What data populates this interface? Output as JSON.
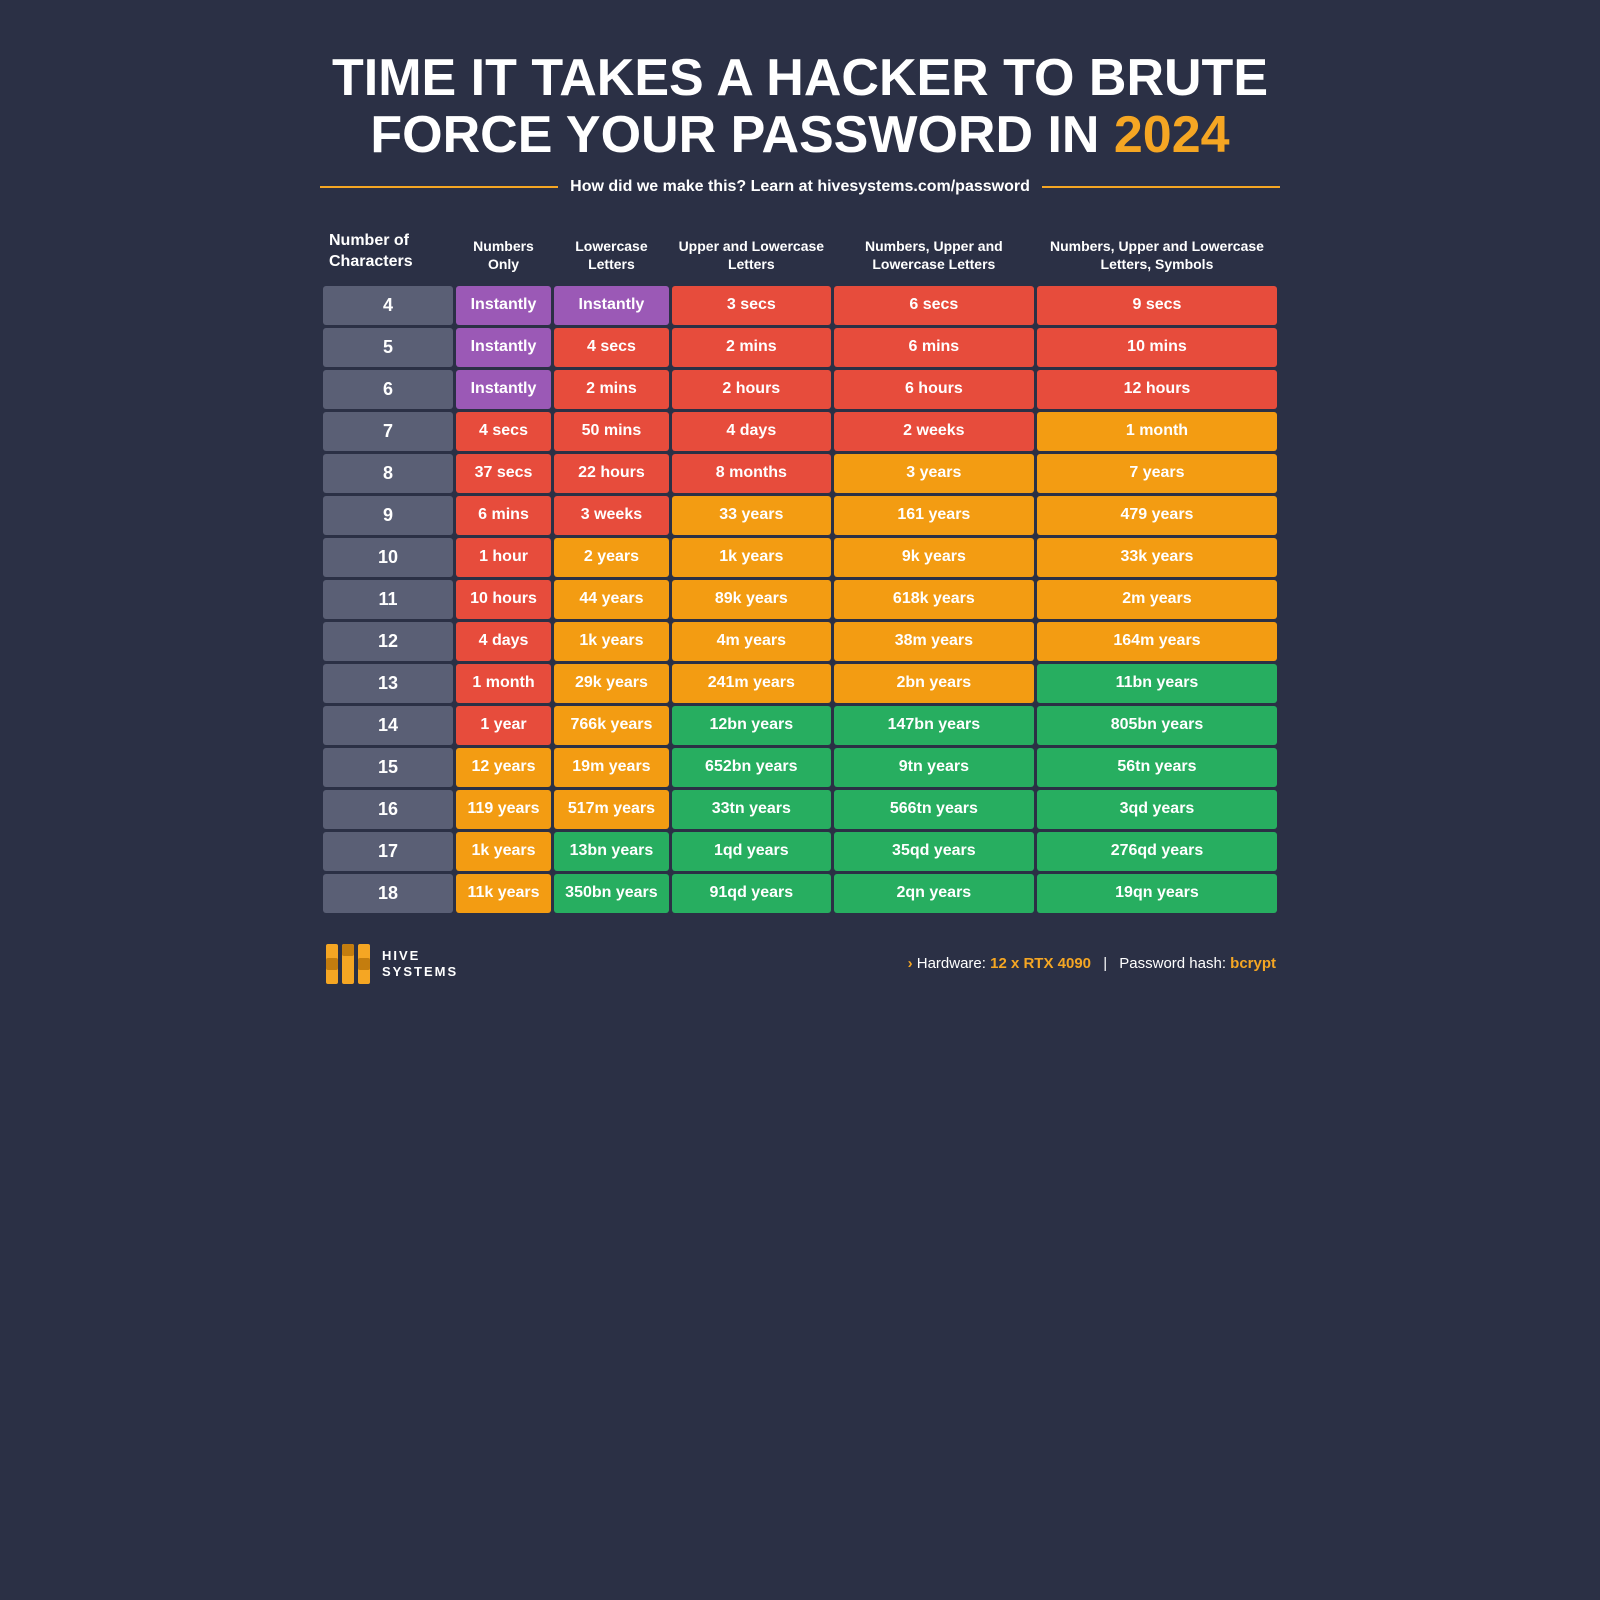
{
  "title": {
    "line1": "TIME IT TAKES A HACKER TO BRUTE",
    "line2": "FORCE YOUR PASSWORD IN",
    "year": "2024"
  },
  "subtitle": "How did we make this? Learn at hivesystems.com/password",
  "table": {
    "headers": [
      "Number of Characters",
      "Numbers Only",
      "Lowercase Letters",
      "Upper and Lowercase Letters",
      "Numbers, Upper and Lowercase Letters",
      "Numbers, Upper and Lowercase Letters, Symbols"
    ],
    "rows": [
      {
        "chars": "4",
        "c1": "Instantly",
        "c1_color": "purple",
        "c2": "Instantly",
        "c2_color": "purple",
        "c3": "3 secs",
        "c3_color": "red",
        "c4": "6 secs",
        "c4_color": "red",
        "c5": "9 secs",
        "c5_color": "red"
      },
      {
        "chars": "5",
        "c1": "Instantly",
        "c1_color": "purple",
        "c2": "4 secs",
        "c2_color": "red",
        "c3": "2 mins",
        "c3_color": "red",
        "c4": "6 mins",
        "c4_color": "red",
        "c5": "10 mins",
        "c5_color": "red"
      },
      {
        "chars": "6",
        "c1": "Instantly",
        "c1_color": "purple",
        "c2": "2 mins",
        "c2_color": "red",
        "c3": "2 hours",
        "c3_color": "red",
        "c4": "6 hours",
        "c4_color": "red",
        "c5": "12 hours",
        "c5_color": "red"
      },
      {
        "chars": "7",
        "c1": "4 secs",
        "c1_color": "red",
        "c2": "50 mins",
        "c2_color": "red",
        "c3": "4 days",
        "c3_color": "red",
        "c4": "2 weeks",
        "c4_color": "red",
        "c5": "1 month",
        "c5_color": "orange"
      },
      {
        "chars": "8",
        "c1": "37 secs",
        "c1_color": "red",
        "c2": "22 hours",
        "c2_color": "red",
        "c3": "8 months",
        "c3_color": "red",
        "c4": "3 years",
        "c4_color": "orange",
        "c5": "7 years",
        "c5_color": "orange"
      },
      {
        "chars": "9",
        "c1": "6 mins",
        "c1_color": "red",
        "c2": "3 weeks",
        "c2_color": "red",
        "c3": "33 years",
        "c3_color": "orange",
        "c4": "161 years",
        "c4_color": "orange",
        "c5": "479 years",
        "c5_color": "orange"
      },
      {
        "chars": "10",
        "c1": "1 hour",
        "c1_color": "red",
        "c2": "2 years",
        "c2_color": "orange",
        "c3": "1k years",
        "c3_color": "orange",
        "c4": "9k years",
        "c4_color": "orange",
        "c5": "33k years",
        "c5_color": "orange"
      },
      {
        "chars": "11",
        "c1": "10 hours",
        "c1_color": "red",
        "c2": "44 years",
        "c2_color": "orange",
        "c3": "89k years",
        "c3_color": "orange",
        "c4": "618k years",
        "c4_color": "orange",
        "c5": "2m years",
        "c5_color": "orange"
      },
      {
        "chars": "12",
        "c1": "4 days",
        "c1_color": "red",
        "c2": "1k years",
        "c2_color": "orange",
        "c3": "4m years",
        "c3_color": "orange",
        "c4": "38m years",
        "c4_color": "orange",
        "c5": "164m years",
        "c5_color": "orange"
      },
      {
        "chars": "13",
        "c1": "1 month",
        "c1_color": "red",
        "c2": "29k years",
        "c2_color": "orange",
        "c3": "241m years",
        "c3_color": "orange",
        "c4": "2bn years",
        "c4_color": "orange",
        "c5": "11bn years",
        "c5_color": "green"
      },
      {
        "chars": "14",
        "c1": "1 year",
        "c1_color": "red",
        "c2": "766k years",
        "c2_color": "orange",
        "c3": "12bn years",
        "c3_color": "green",
        "c4": "147bn years",
        "c4_color": "green",
        "c5": "805bn years",
        "c5_color": "green"
      },
      {
        "chars": "15",
        "c1": "12 years",
        "c1_color": "orange",
        "c2": "19m years",
        "c2_color": "orange",
        "c3": "652bn years",
        "c3_color": "green",
        "c4": "9tn years",
        "c4_color": "green",
        "c5": "56tn years",
        "c5_color": "green"
      },
      {
        "chars": "16",
        "c1": "119 years",
        "c1_color": "orange",
        "c2": "517m years",
        "c2_color": "orange",
        "c3": "33tn years",
        "c3_color": "green",
        "c4": "566tn years",
        "c4_color": "green",
        "c5": "3qd years",
        "c5_color": "green"
      },
      {
        "chars": "17",
        "c1": "1k years",
        "c1_color": "orange",
        "c2": "13bn years",
        "c2_color": "green",
        "c3": "1qd years",
        "c3_color": "green",
        "c4": "35qd years",
        "c4_color": "green",
        "c5": "276qd years",
        "c5_color": "green"
      },
      {
        "chars": "18",
        "c1": "11k years",
        "c1_color": "orange",
        "c2": "350bn years",
        "c2_color": "green",
        "c3": "91qd years",
        "c3_color": "green",
        "c4": "2qn years",
        "c4_color": "green",
        "c5": "19qn years",
        "c5_color": "green"
      }
    ]
  },
  "footer": {
    "logo_line1": "HIVE",
    "logo_line2": "SYSTEMS",
    "hardware_label": "Hardware:",
    "hardware_value": "12 x RTX 4090",
    "hash_label": "Password hash:",
    "hash_value": "bcrypt",
    "arrow": "›"
  }
}
